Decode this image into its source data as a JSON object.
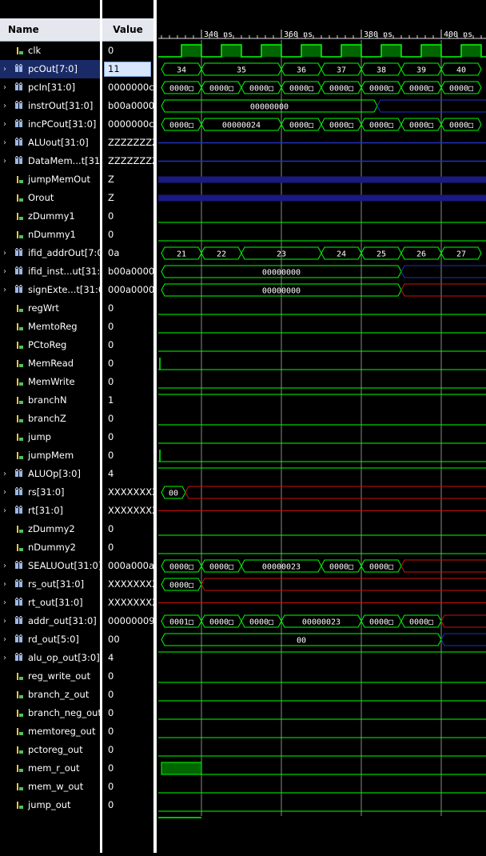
{
  "header": {
    "name_label": "Name",
    "value_label": "Value"
  },
  "timeline": {
    "labels": [
      {
        "t": 340,
        "text": "340 ns"
      },
      {
        "t": 360,
        "text": "360 ns"
      },
      {
        "t": 380,
        "text": "380 ns"
      },
      {
        "t": 400,
        "text": "400 ns"
      }
    ]
  },
  "signals": [
    {
      "name": "clk",
      "value": "0",
      "icon": "bit-signal-icon",
      "expand": false
    },
    {
      "name": "pcOut[7:0]",
      "value": "11",
      "icon": "bus-signal-icon",
      "expand": true,
      "selected": true
    },
    {
      "name": "pcIn[31:0]",
      "value": "0000000c",
      "icon": "bus-signal-icon",
      "expand": true
    },
    {
      "name": "instrOut[31:0]",
      "value": "b00a0000",
      "icon": "bus-signal-icon",
      "expand": true
    },
    {
      "name": "incPCout[31:0]",
      "value": "0000000c",
      "icon": "bus-signal-icon",
      "expand": true
    },
    {
      "name": "ALUout[31:0]",
      "value": "ZZZZZZZZ",
      "icon": "bus-signal-icon",
      "expand": true
    },
    {
      "name": "DataMem...t[31:0]",
      "value": "ZZZZZZZZ",
      "icon": "bus-signal-icon",
      "expand": true
    },
    {
      "name": "jumpMemOut",
      "value": "Z",
      "icon": "bit-signal-icon",
      "expand": false
    },
    {
      "name": "Orout",
      "value": "Z",
      "icon": "bit-signal-icon",
      "expand": false
    },
    {
      "name": "zDummy1",
      "value": "0",
      "icon": "bit-signal-icon",
      "expand": false
    },
    {
      "name": "nDummy1",
      "value": "0",
      "icon": "bit-signal-icon",
      "expand": false
    },
    {
      "name": "ifid_addrOut[7:0]",
      "value": "0a",
      "icon": "bus-signal-icon",
      "expand": true
    },
    {
      "name": "ifid_inst...ut[31:0]",
      "value": "b00a0000",
      "icon": "bus-signal-icon",
      "expand": true
    },
    {
      "name": "signExte...t[31:0]",
      "value": "000a0000",
      "icon": "bus-signal-icon",
      "expand": true
    },
    {
      "name": "regWrt",
      "value": "0",
      "icon": "bit-signal-icon",
      "expand": false
    },
    {
      "name": "MemtoReg",
      "value": "0",
      "icon": "bit-signal-icon",
      "expand": false
    },
    {
      "name": "PCtoReg",
      "value": "0",
      "icon": "bit-signal-icon",
      "expand": false
    },
    {
      "name": "MemRead",
      "value": "0",
      "icon": "bit-signal-icon",
      "expand": false
    },
    {
      "name": "MemWrite",
      "value": "0",
      "icon": "bit-signal-icon",
      "expand": false
    },
    {
      "name": "branchN",
      "value": "1",
      "icon": "bit-signal-icon",
      "expand": false
    },
    {
      "name": "branchZ",
      "value": "0",
      "icon": "bit-signal-icon",
      "expand": false
    },
    {
      "name": "jump",
      "value": "0",
      "icon": "bit-signal-icon",
      "expand": false
    },
    {
      "name": "jumpMem",
      "value": "0",
      "icon": "bit-signal-icon",
      "expand": false
    },
    {
      "name": "ALUOp[3:0]",
      "value": "4",
      "icon": "bus-signal-icon",
      "expand": true
    },
    {
      "name": "rs[31:0]",
      "value": "XXXXXXXX",
      "icon": "bus-signal-icon",
      "expand": true
    },
    {
      "name": "rt[31:0]",
      "value": "XXXXXXXX",
      "icon": "bus-signal-icon",
      "expand": true
    },
    {
      "name": "zDummy2",
      "value": "0",
      "icon": "bit-signal-icon",
      "expand": false
    },
    {
      "name": "nDummy2",
      "value": "0",
      "icon": "bit-signal-icon",
      "expand": false
    },
    {
      "name": "SEALUOut[31:0]",
      "value": "000a000a",
      "icon": "bus-signal-icon",
      "expand": true
    },
    {
      "name": "rs_out[31:0]",
      "value": "XXXXXXXX",
      "icon": "bus-signal-icon",
      "expand": true
    },
    {
      "name": "rt_out[31:0]",
      "value": "XXXXXXXX",
      "icon": "bus-signal-icon",
      "expand": true
    },
    {
      "name": "addr_out[31:0]",
      "value": "00000009",
      "icon": "bus-signal-icon",
      "expand": true
    },
    {
      "name": "rd_out[5:0]",
      "value": "00",
      "icon": "bus-signal-icon",
      "expand": true
    },
    {
      "name": "alu_op_out[3:0]",
      "value": "4",
      "icon": "bus-signal-icon",
      "expand": true
    },
    {
      "name": "reg_write_out",
      "value": "0",
      "icon": "bit-signal-icon",
      "expand": false
    },
    {
      "name": "branch_z_out",
      "value": "0",
      "icon": "bit-signal-icon",
      "expand": false
    },
    {
      "name": "branch_neg_out",
      "value": "0",
      "icon": "bit-signal-icon",
      "expand": false
    },
    {
      "name": "memtoreg_out",
      "value": "0",
      "icon": "bit-signal-icon",
      "expand": false
    },
    {
      "name": "pctoreg_out",
      "value": "0",
      "icon": "bit-signal-icon",
      "expand": false
    },
    {
      "name": "mem_r_out",
      "value": "0",
      "icon": "bit-signal-icon",
      "expand": false
    },
    {
      "name": "mem_w_out",
      "value": "0",
      "icon": "bit-signal-icon",
      "expand": false
    },
    {
      "name": "jump_out",
      "value": "0",
      "icon": "bit-signal-icon",
      "expand": false
    }
  ],
  "waves": {
    "clk": {
      "kind": "clock",
      "period": 10,
      "high_start": 335
    },
    "pcOut[7:0]": {
      "kind": "bus",
      "segments": [
        [
          "34",
          330,
          340
        ],
        [
          "35",
          340,
          360
        ],
        [
          "36",
          360,
          370
        ],
        [
          "37",
          370,
          380
        ],
        [
          "38",
          380,
          390
        ],
        [
          "39",
          390,
          400
        ],
        [
          "40",
          400,
          410
        ]
      ]
    },
    "pcIn[31:0]": {
      "kind": "bus",
      "segments": [
        [
          "0000□",
          330,
          340
        ],
        [
          "0000□",
          340,
          350
        ],
        [
          "0000□",
          350,
          360
        ],
        [
          "0000□",
          360,
          370
        ],
        [
          "0000□",
          370,
          380
        ],
        [
          "0000□",
          380,
          390
        ],
        [
          "0000□",
          390,
          400
        ],
        [
          "0000□",
          400,
          410
        ]
      ]
    },
    "instrOut[31:0]": {
      "kind": "bus",
      "segments": [
        [
          "00000000",
          330,
          384
        ]
      ],
      "after": "blue",
      "after_start": 384
    },
    "incPCout[31:0]": {
      "kind": "bus",
      "segments": [
        [
          "0000□",
          330,
          340
        ],
        [
          "00000024",
          340,
          360
        ],
        [
          "0000□",
          360,
          370
        ],
        [
          "0000□",
          370,
          380
        ],
        [
          "0000□",
          380,
          390
        ],
        [
          "0000□",
          390,
          400
        ],
        [
          "0000□",
          400,
          410
        ]
      ]
    },
    "ALUout[31:0]": {
      "kind": "z",
      "style": "line"
    },
    "DataMem...t[31:0]": {
      "kind": "z",
      "style": "line"
    },
    "jumpMemOut": {
      "kind": "z",
      "style": "thick"
    },
    "Orout": {
      "kind": "z",
      "style": "thick"
    },
    "zDummy1": {
      "kind": "low"
    },
    "nDummy1": {
      "kind": "low"
    },
    "ifid_addrOut[7:0]": {
      "kind": "bus",
      "segments": [
        [
          "21",
          330,
          340
        ],
        [
          "22",
          340,
          350
        ],
        [
          "23",
          350,
          370
        ],
        [
          "24",
          370,
          380
        ],
        [
          "25",
          380,
          390
        ],
        [
          "26",
          390,
          400
        ],
        [
          "27",
          400,
          410
        ]
      ]
    },
    "ifid_inst...ut[31:0]": {
      "kind": "bus",
      "segments": [
        [
          "00000000",
          330,
          390
        ]
      ],
      "after": "blue",
      "after_start": 390
    },
    "signExte...t[31:0]": {
      "kind": "bus",
      "segments": [
        [
          "00000000",
          330,
          390
        ]
      ],
      "after": "red",
      "after_start": 390
    },
    "regWrt": {
      "kind": "low"
    },
    "MemtoReg": {
      "kind": "low"
    },
    "PCtoReg": {
      "kind": "low"
    },
    "MemRead": {
      "kind": "low",
      "spike": true
    },
    "MemWrite": {
      "kind": "low"
    },
    "branchN": {
      "kind": "high"
    },
    "branchZ": {
      "kind": "low"
    },
    "jump": {
      "kind": "low"
    },
    "jumpMem": {
      "kind": "low",
      "spike": true
    },
    "ALUOp[3:0]": {
      "kind": "high"
    },
    "rs[31:0]": {
      "kind": "bus",
      "segments": [
        [
          "00",
          330,
          336
        ]
      ],
      "after": "red",
      "after_start": 336
    },
    "rt[31:0]": {
      "kind": "x"
    },
    "zDummy2": {
      "kind": "low"
    },
    "nDummy2": {
      "kind": "low"
    },
    "SEALUOut[31:0]": {
      "kind": "bus",
      "segments": [
        [
          "0000□",
          330,
          340
        ],
        [
          "0000□",
          340,
          350
        ],
        [
          "00000023",
          350,
          370
        ],
        [
          "0000□",
          370,
          380
        ],
        [
          "0000□",
          380,
          390
        ]
      ],
      "after": "red",
      "after_start": 390
    },
    "rs_out[31:0]": {
      "kind": "bus",
      "segments": [
        [
          "0000□",
          330,
          340
        ]
      ],
      "after": "red",
      "after_start": 340
    },
    "rt_out[31:0]": {
      "kind": "x"
    },
    "addr_out[31:0]": {
      "kind": "bus",
      "segments": [
        [
          "0001□",
          330,
          340
        ],
        [
          "0000□",
          340,
          350
        ],
        [
          "0000□",
          350,
          360
        ],
        [
          "00000023",
          360,
          380
        ],
        [
          "0000□",
          380,
          390
        ],
        [
          "0000□",
          390,
          400
        ]
      ],
      "after": "red",
      "after_start": 400
    },
    "rd_out[5:0]": {
      "kind": "bus",
      "segments": [
        [
          "00",
          330,
          400
        ]
      ],
      "after": "blue",
      "after_start": 400
    },
    "alu_op_out[3:0]": {
      "kind": "high"
    },
    "reg_write_out": {
      "kind": "low"
    },
    "branch_z_out": {
      "kind": "low"
    },
    "branch_neg_out": {
      "kind": "low"
    },
    "memtoreg_out": {
      "kind": "low"
    },
    "pctoreg_out": {
      "kind": "low"
    },
    "mem_r_out": {
      "kind": "pulse",
      "from": 330,
      "to": 340
    },
    "mem_w_out": {
      "kind": "low"
    },
    "jump_out": {
      "kind": "low"
    }
  },
  "colors": {
    "wave_green": "#00ff00",
    "fill_green": "#006600",
    "z_blue": "#2030c0",
    "x_red": "#d01010",
    "select_blue": "#1a2a66"
  }
}
